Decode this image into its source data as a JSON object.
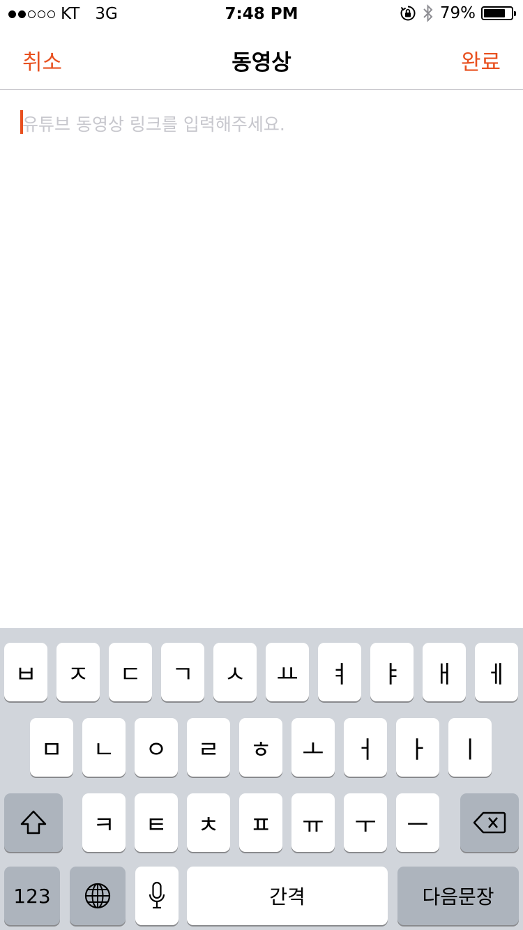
{
  "status_bar": {
    "signal_bars_filled": 2,
    "signal_bars_total": 5,
    "carrier": "KT",
    "network": "3G",
    "time": "7:48 PM",
    "battery_percent": "79%",
    "battery_level": 0.79,
    "icons": [
      "rotation-lock-icon",
      "bluetooth-icon",
      "battery-icon"
    ]
  },
  "nav": {
    "cancel": "취소",
    "title": "동영상",
    "done": "완료",
    "accent_color": "#e8501f"
  },
  "editor": {
    "placeholder": "유튜브 동영상 링크를 입력해주세요.",
    "value": ""
  },
  "keyboard": {
    "row1": [
      "ㅂ",
      "ㅈ",
      "ㄷ",
      "ㄱ",
      "ㅅ",
      "ㅛ",
      "ㅕ",
      "ㅑ",
      "ㅐ",
      "ㅔ"
    ],
    "row2": [
      "ㅁ",
      "ㄴ",
      "ㅇ",
      "ㄹ",
      "ㅎ",
      "ㅗ",
      "ㅓ",
      "ㅏ",
      "ㅣ"
    ],
    "row3": [
      "ㅋ",
      "ㅌ",
      "ㅊ",
      "ㅍ",
      "ㅠ",
      "ㅜ",
      "ㅡ"
    ],
    "numbers": "123",
    "space": "간격",
    "return": "다음문장",
    "special_keys": [
      "shift-icon",
      "delete-icon",
      "globe-icon",
      "microphone-icon"
    ]
  }
}
